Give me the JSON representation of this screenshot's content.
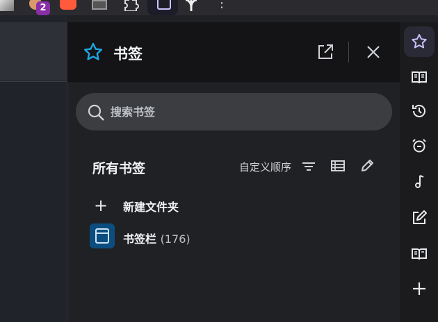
{
  "toolbar": {
    "badge_count": "2",
    "extensions": [
      "ext-icon-1",
      "ext-icon-2",
      "ext-icon-3",
      "ext-icon-4",
      "puzzle-icon",
      "sidebar-toggle-icon",
      "ai-icon"
    ],
    "menu_glyph": "⋮"
  },
  "panel": {
    "title": "书签",
    "search_placeholder": "搜索书签",
    "section_title": "所有书签",
    "sort_label": "自定义顺序",
    "new_folder_label": "新建文件夹",
    "items": [
      {
        "name": "书签栏",
        "count": "(176)"
      }
    ]
  },
  "sidebar": {
    "buttons": [
      "bookmarks-icon",
      "reading-list-icon",
      "history-icon",
      "alarm-icon",
      "music-icon",
      "notes-icon",
      "reader-icon",
      "add-icon"
    ],
    "active": "bookmarks-icon"
  },
  "colors": {
    "accent_star": "#1ea7e6",
    "folder_bg": "#0b4d7e",
    "active_star": "#c7c2ff"
  }
}
